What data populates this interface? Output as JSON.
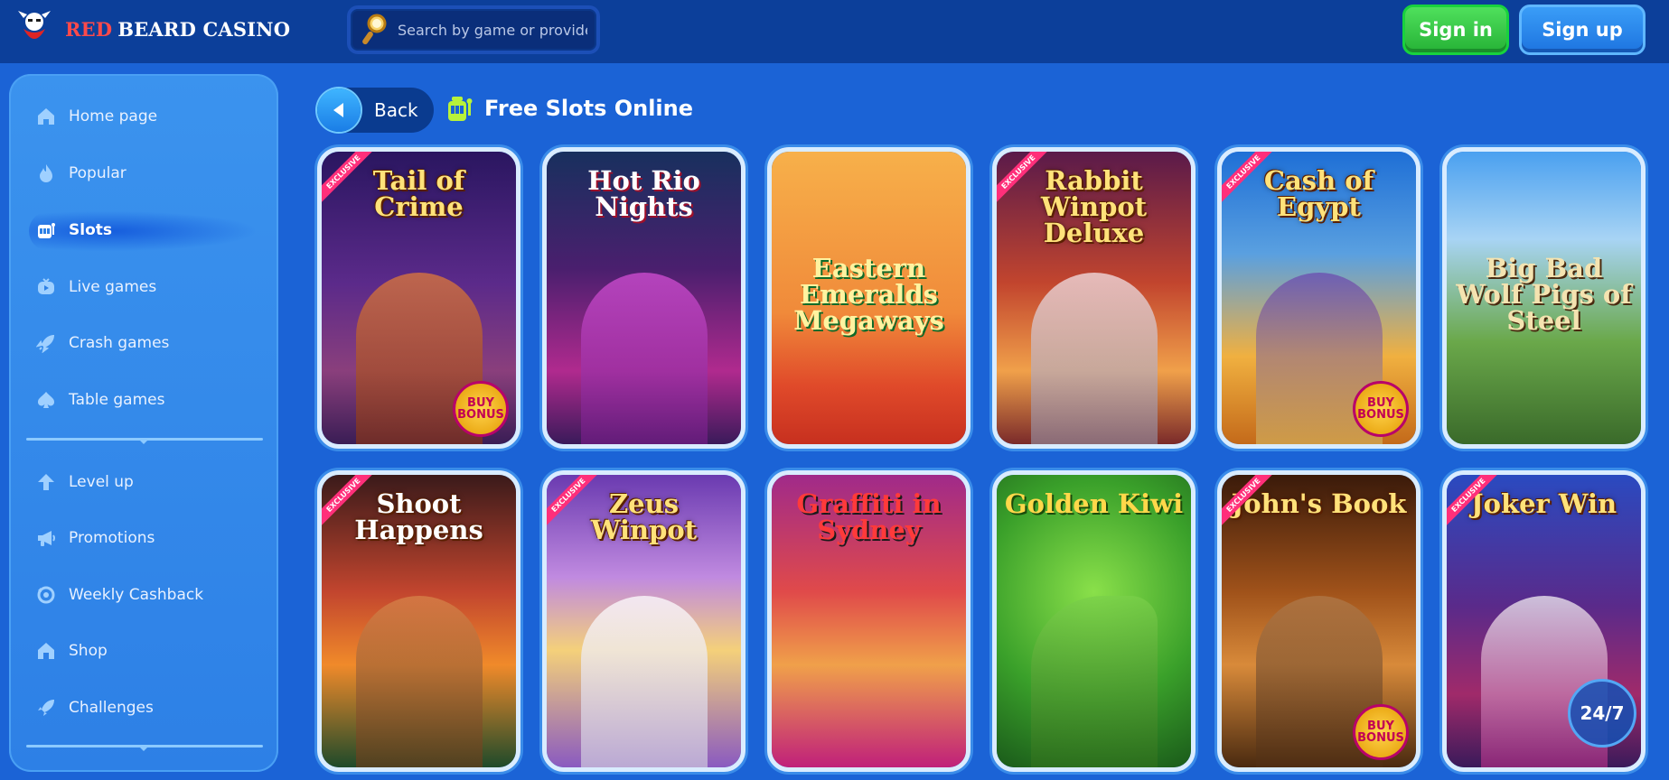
{
  "brand": {
    "name_red": "RED",
    "name_rest": "BEARD CASINO"
  },
  "search": {
    "placeholder": "Search by game or provider"
  },
  "auth": {
    "sign_in": "Sign in",
    "sign_up": "Sign up"
  },
  "sidebar": {
    "items": [
      {
        "label": "Home page",
        "icon": "home-icon"
      },
      {
        "label": "Popular",
        "icon": "flame-icon"
      },
      {
        "label": "Slots",
        "icon": "slot-machine-icon",
        "active": true
      },
      {
        "label": "Live games",
        "icon": "live-icon"
      },
      {
        "label": "Crash games",
        "icon": "rocket-icon"
      },
      {
        "label": "Table games",
        "icon": "spade-icon"
      },
      {
        "label": "Level up",
        "icon": "arrow-up-icon"
      },
      {
        "label": "Promotions",
        "icon": "megaphone-icon"
      },
      {
        "label": "Weekly Cashback",
        "icon": "cashback-icon"
      },
      {
        "label": "Shop",
        "icon": "shop-icon"
      },
      {
        "label": "Challenges",
        "icon": "rocket-icon"
      }
    ]
  },
  "page": {
    "back_label": "Back",
    "title": "Free Slots Online"
  },
  "games": [
    {
      "name": "Tail of Crime",
      "exclusive": true,
      "buy_bonus": true
    },
    {
      "name": "Hot Rio Nights",
      "exclusive": false,
      "buy_bonus": false
    },
    {
      "name": "Eastern Emeralds Megaways",
      "exclusive": false,
      "buy_bonus": false
    },
    {
      "name": "Rabbit Winpot Deluxe",
      "exclusive": true,
      "buy_bonus": false
    },
    {
      "name": "Cash of Egypt",
      "exclusive": true,
      "buy_bonus": true
    },
    {
      "name": "Big Bad Wolf Pigs of Steel",
      "exclusive": false,
      "buy_bonus": false
    },
    {
      "name": "Shoot Happens",
      "exclusive": true,
      "buy_bonus": false
    },
    {
      "name": "Zeus Winpot",
      "exclusive": true,
      "buy_bonus": false
    },
    {
      "name": "Graffiti in Sydney",
      "exclusive": false,
      "buy_bonus": false
    },
    {
      "name": "Golden Kiwi",
      "exclusive": false,
      "buy_bonus": false
    },
    {
      "name": "John's Book",
      "exclusive": true,
      "buy_bonus": true
    },
    {
      "name": "Joker Win",
      "exclusive": true,
      "buy_bonus": false
    }
  ],
  "badges": {
    "exclusive": "EXCLUSIVE",
    "buy_bonus": "BUY BONUS"
  },
  "support": {
    "label": "24/7"
  },
  "colors": {
    "header": "#0c3f9a",
    "background": "#1b63d6",
    "sign_in": "#2fc03f",
    "sign_up": "#2a86ef",
    "accent_red": "#ff4a4a"
  }
}
